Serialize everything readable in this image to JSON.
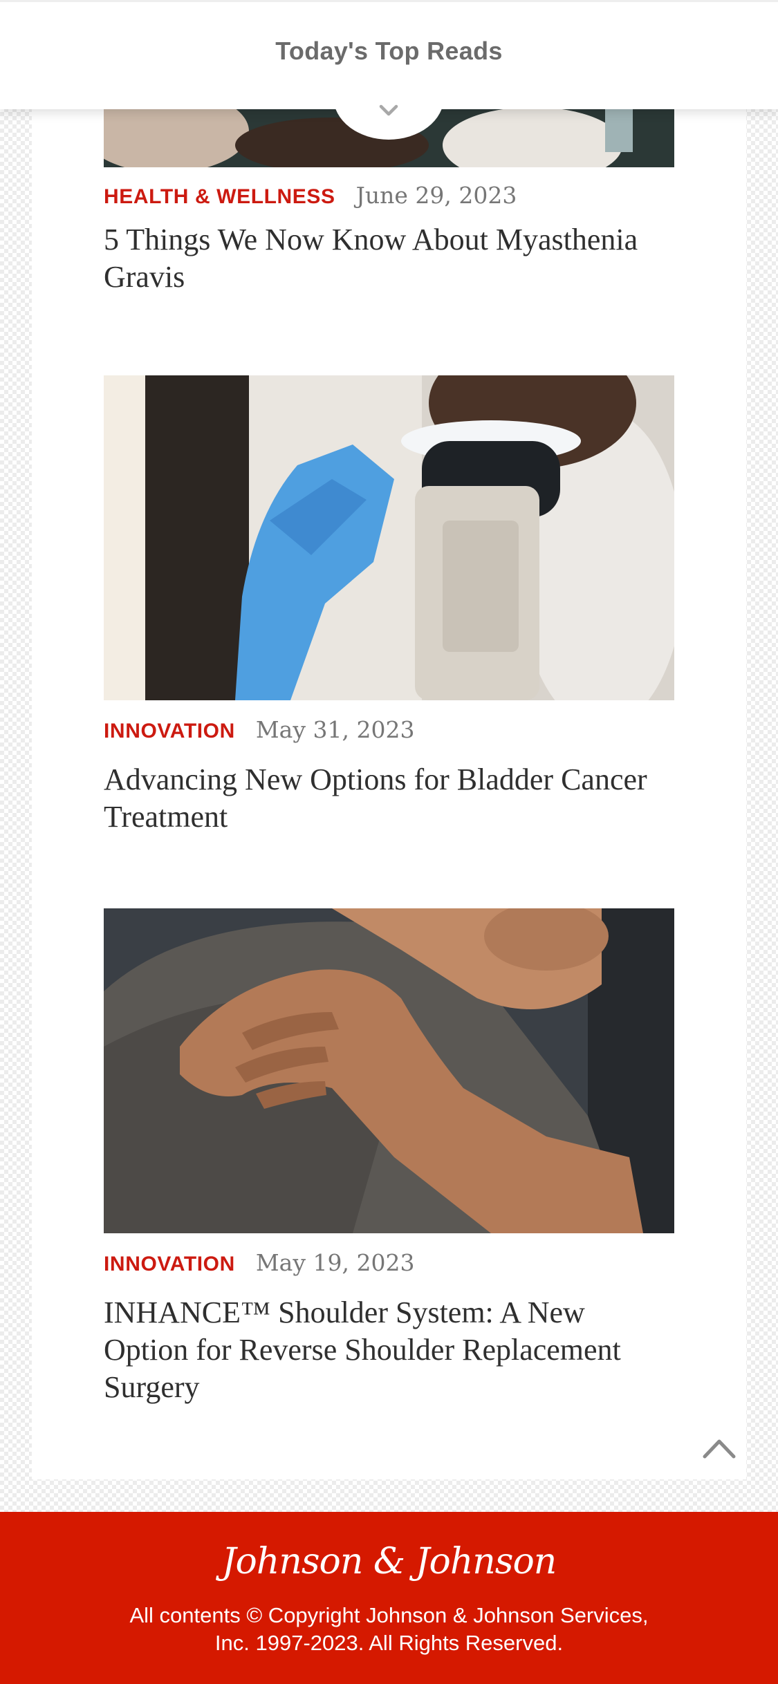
{
  "header": {
    "title": "Today's Top Reads"
  },
  "articles": [
    {
      "category": "HEALTH & WELLNESS",
      "date": "June 29, 2023",
      "title": "5 Things We Now Know About Myasthenia Gravis"
    },
    {
      "category": "INNOVATION",
      "date": "May 31, 2023",
      "title": "Advancing New Options for Bladder Cancer Treatment"
    },
    {
      "category": "INNOVATION",
      "date": "May 19, 2023",
      "title": "INHANCE™ Shoulder System: A New Option for Reverse Shoulder Replacement Surgery"
    }
  ],
  "footer": {
    "logo_text": "Johnson & Johnson",
    "copyright": "All contents © Copyright Johnson & Johnson Services, Inc. 1997-2023. All Rights Reserved."
  },
  "icons": {
    "collapse": "chevron-down-icon",
    "scroll_top": "chevron-up-icon"
  },
  "colors": {
    "brand_red": "#d51900",
    "category_red": "#cc1a10",
    "headline": "#2f2f2f",
    "date_gray": "#767676"
  }
}
